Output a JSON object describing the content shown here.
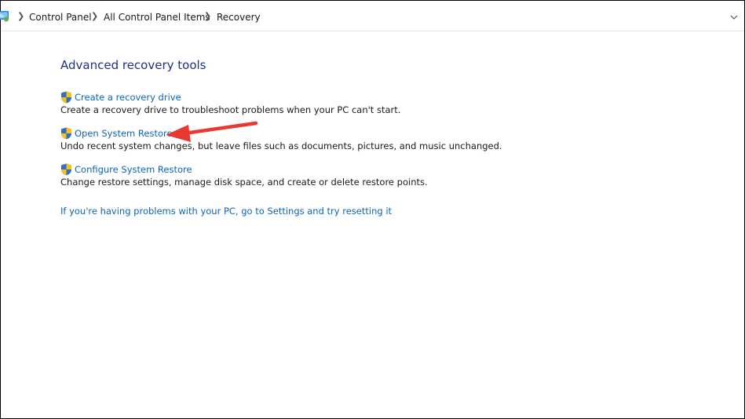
{
  "address_bar": {
    "icon": "control-panel-icon",
    "breadcrumbs": [
      "Control Panel",
      "All Control Panel Items",
      "Recovery"
    ],
    "separator_icon": "chevron-right-icon",
    "dropdown_icon": "chevron-down-icon"
  },
  "main": {
    "title": "Advanced recovery tools",
    "tools": [
      {
        "icon": "uac-shield-icon",
        "label": "Create a recovery drive",
        "description": "Create a recovery drive to troubleshoot problems when your PC can't start."
      },
      {
        "icon": "uac-shield-icon",
        "label": "Open System Restore",
        "description": "Undo recent system changes, but leave files such as documents, pictures, and music unchanged."
      },
      {
        "icon": "uac-shield-icon",
        "label": "Configure System Restore",
        "description": "Change restore settings, manage disk space, and create or delete restore points."
      }
    ],
    "reset_link": "If you're having problems with your PC, go to Settings and try resetting it"
  },
  "annotation": {
    "icon": "red-arrow-icon",
    "color": "#e8382f"
  },
  "colors": {
    "title": "#1e3287",
    "link": "#0a66b8",
    "text": "#1a1a1a"
  }
}
